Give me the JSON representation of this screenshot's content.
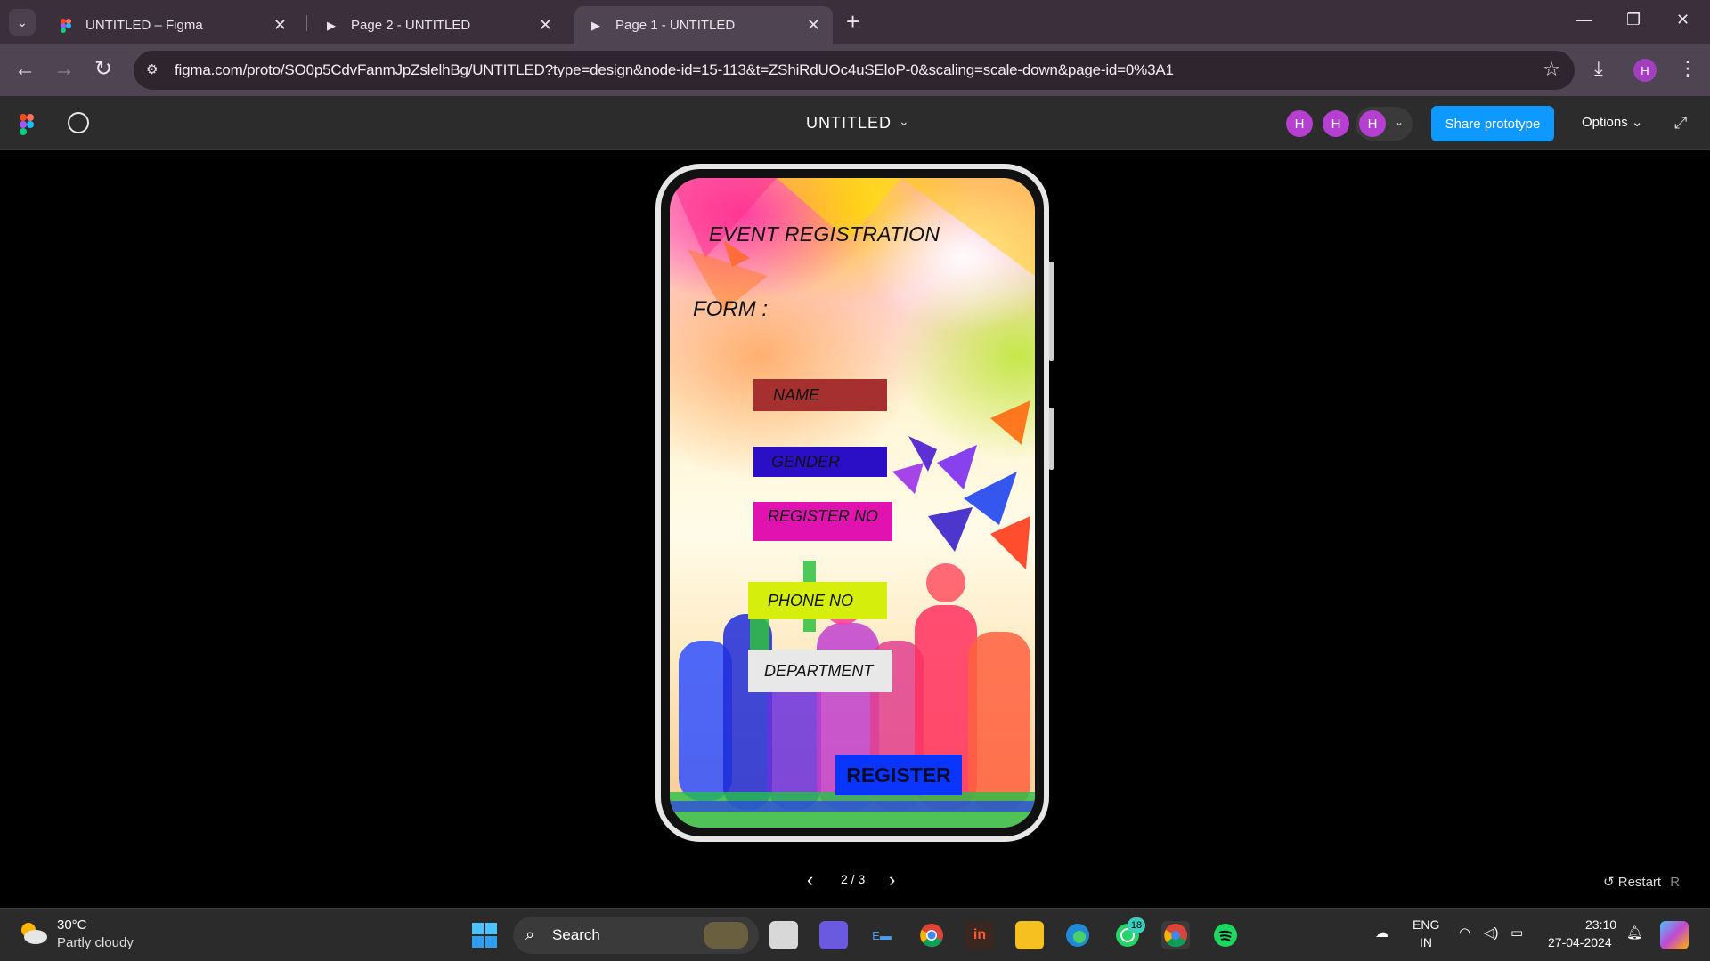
{
  "browser": {
    "tabs": [
      {
        "label": "UNTITLED – Figma",
        "icon": "figma-logo-icon",
        "active": false
      },
      {
        "label": "Page 2 - UNTITLED",
        "icon": "play-icon",
        "active": false
      },
      {
        "label": "Page 1 - UNTITLED",
        "icon": "play-icon",
        "active": true
      }
    ],
    "url": "figma.com/proto/SO0p5CdvFanmJpZslelhBg/UNTITLED?type=design&node-id=15-113&t=ZShiRdUOc4uSEloP-0&scaling=scale-down&page-id=0%3A1",
    "profile_initial": "H"
  },
  "figma": {
    "file_title": "UNTITLED",
    "avatars": [
      "H",
      "H",
      "H"
    ],
    "share_label": "Share prototype",
    "options_label": "Options",
    "pager": "2 / 3",
    "restart_label": "Restart",
    "restart_shortcut": "R"
  },
  "prototype": {
    "title": "EVENT REGISTRATION",
    "form_label": "FORM :",
    "fields": [
      {
        "label": "NAME",
        "color": "#a5302f"
      },
      {
        "label": "GENDER",
        "color": "#2a0fc6"
      },
      {
        "label": "REGISTER NO",
        "color": "#e012b0"
      },
      {
        "label": "PHONE NO",
        "color": "#d6ee0c"
      },
      {
        "label": "DEPARTMENT",
        "color": "#e8e8e8"
      }
    ],
    "register_label": "REGISTER",
    "register_color": "#0a35ff"
  },
  "taskbar": {
    "weather_temp": "30°C",
    "weather_desc": "Partly cloudy",
    "search_label": "Search",
    "whatsapp_badge": "18",
    "lang_top": "ENG",
    "lang_bottom": "IN",
    "time": "23:10",
    "date": "27-04-2024"
  }
}
